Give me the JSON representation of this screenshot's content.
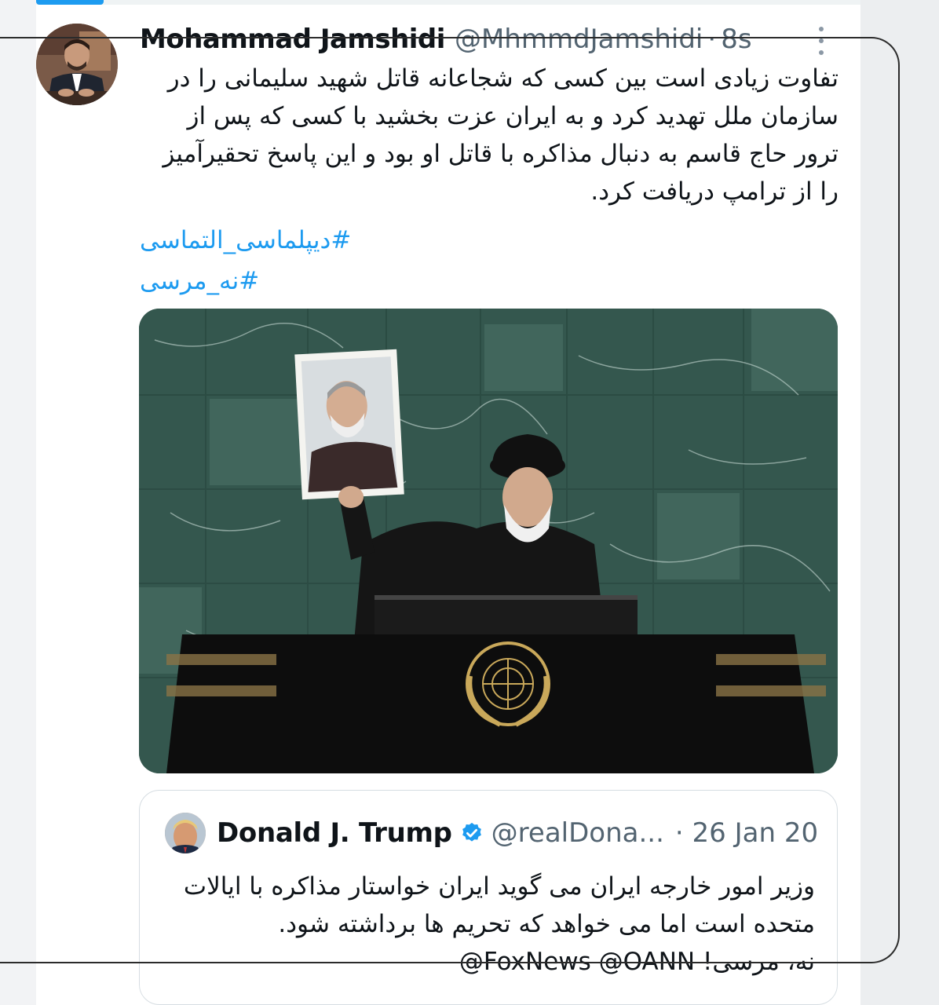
{
  "tweet": {
    "author_name": "Mohammad Jamshidi",
    "author_handle": "@MhmmdJamshidi",
    "separator": "·",
    "timestamp": "8s",
    "text": "تفاوت زیادی است بین کسی که شجاعانه قاتل شهید سلیمانی را در سازمان ملل تهدید کرد و به ایران عزت بخشید با کسی که پس از ترور حاج قاسم به دنبال مذاکره با قاتل او بود و این پاسخ تحقیرآمیز را از ترامپ دریافت کرد.",
    "hashtags": [
      "#دیپلماسی_التماسی",
      "#نه_مرسی"
    ],
    "more_icon": "more-vertical-icon"
  },
  "quoted_tweet": {
    "author_name": "Donald J. Trump",
    "author_handle": "@realDona...",
    "separator": "·",
    "timestamp": "26 Jan 20",
    "verified_icon": "verified-badge-icon",
    "text": "وزیر امور خارجه ایران می گوید ایران خواستار مذاکره با ایالات متحده است اما می خواهد که تحریم ها برداشته شود.",
    "mentions": "@FoxNews @OANN",
    "reply": "نه، مرسی!"
  },
  "colors": {
    "link": "#1d9bf0",
    "secondary_text": "#536471",
    "marble": "#2f5148"
  }
}
